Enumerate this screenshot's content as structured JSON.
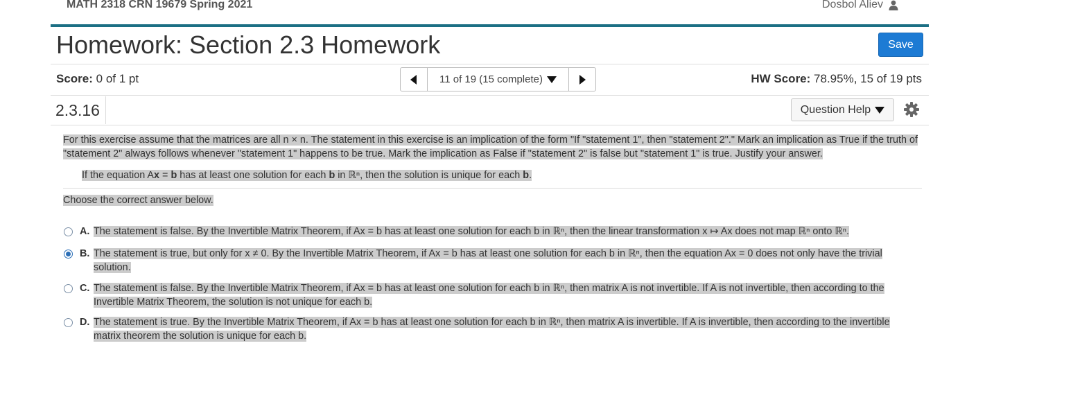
{
  "header": {
    "course": "MATH 2318 CRN 19679 Spring 2021",
    "user_name": "Dosbol Aliev",
    "user_icon": "user-icon"
  },
  "page": {
    "title": "Homework: Section 2.3 Homework",
    "save_label": "Save"
  },
  "scorebar": {
    "score_label": "Score:",
    "score_value": "0 of 1 pt",
    "nav_position": "11 of 19 (15 complete)",
    "hw_score_label": "HW Score:",
    "hw_score_value": "78.95%, 15 of 19 pts"
  },
  "question": {
    "number": "2.3.16",
    "help_label": "Question Help",
    "intro": "For this exercise assume that the matrices are all n × n. The statement in this exercise is an implication of the form \"If \"statement 1\", then \"statement 2\".\" Mark an implication as True if the truth of \"statement 2\" always follows whenever \"statement 1\" happens to be true. Mark the implication as False if \"statement 2\" is false but \"statement 1\" is true. Justify your answer.",
    "statement": {
      "p1": "If the equation A",
      "x": "x",
      "eq": " = ",
      "b": "b",
      "p2": " has at least one solution for each ",
      "p3": " in ℝⁿ, then the solution is unique for each ",
      "end": "."
    },
    "choose_label": "Choose the correct answer below.",
    "selected": "B",
    "options": [
      {
        "letter": "A.",
        "text": "The statement is false. By the Invertible Matrix Theorem, if Ax = b has at least one solution for each b in ℝⁿ, then the linear transformation x ↦ Ax does not map ℝⁿ onto ℝⁿ."
      },
      {
        "letter": "B.",
        "text": "The statement is true, but only for x ≠ 0. By the Invertible Matrix Theorem, if Ax = b has at least one solution for each b in ℝⁿ, then the equation Ax = 0 does not only have the trivial solution."
      },
      {
        "letter": "C.",
        "text": "The statement is false. By the Invertible Matrix Theorem, if Ax = b has at least one solution for each b in ℝⁿ, then matrix A is not invertible. If A is not invertible, then according to the Invertible Matrix Theorem, the solution is not unique for each b."
      },
      {
        "letter": "D.",
        "text": "The statement is true. By the Invertible Matrix Theorem, if Ax = b has at least one solution for each b in ℝⁿ, then matrix A is invertible. If A is invertible, then according to the invertible matrix theorem the solution is unique for each b."
      }
    ]
  },
  "colors": {
    "accent_rule": "#1b6f84",
    "save_button": "#1d7bd4",
    "highlight": "#cccccc",
    "radio_selected": "#2c6fb7"
  }
}
